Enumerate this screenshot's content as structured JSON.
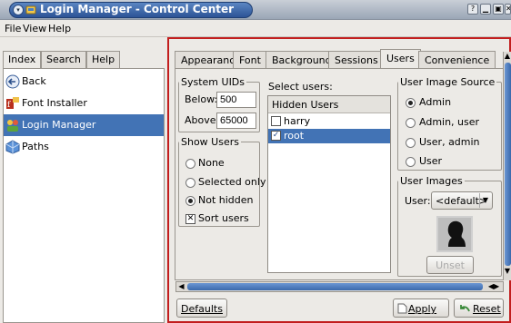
{
  "window": {
    "title": "Login Manager - Control Center",
    "menu_glyph": "▾",
    "help_btn": "?",
    "min_btn": "▁",
    "max_btn": "▣",
    "close_btn": "✕"
  },
  "menubar": {
    "file": "File",
    "view": "View",
    "help": "Help"
  },
  "left": {
    "tabs": [
      "Index",
      "Search",
      "Help"
    ],
    "tree": [
      {
        "label": "Back",
        "icon": "back-arrow-icon"
      },
      {
        "label": "Font Installer",
        "icon": "font-installer-icon"
      },
      {
        "label": "Login Manager",
        "icon": "login-manager-icon",
        "selected": true
      },
      {
        "label": "Paths",
        "icon": "paths-icon"
      }
    ]
  },
  "tabs": [
    "Appearance",
    "Font",
    "Background",
    "Sessions",
    "Users",
    "Convenience"
  ],
  "active_tab": "Users",
  "system_uids": {
    "legend": "System UIDs",
    "below_label": "Below:",
    "below_value": "500",
    "above_label": "Above:",
    "above_value": "65000"
  },
  "show_users": {
    "legend": "Show Users",
    "options": [
      "None",
      "Selected only",
      "Not hidden"
    ],
    "selected": "Not hidden",
    "sort_label": "Sort users",
    "sort_checked": true
  },
  "select_users": {
    "label": "Select users:",
    "header": "Hidden Users",
    "users": [
      {
        "name": "harry",
        "checked": false
      },
      {
        "name": "root",
        "checked": true,
        "selected": true
      }
    ]
  },
  "image_source": {
    "legend": "User Image Source",
    "options": [
      "Admin",
      "Admin, user",
      "User, admin",
      "User"
    ],
    "selected": "Admin"
  },
  "user_images": {
    "legend": "User Images",
    "user_label": "User:",
    "user_value": "<default>",
    "unset_label": "Unset"
  },
  "buttons": {
    "defaults": "Defaults",
    "apply": "Apply",
    "reset": "Reset"
  },
  "colors": {
    "selection": "#4273b5",
    "highlight_border": "#c21e1e",
    "titlebar": "#2c5396"
  }
}
